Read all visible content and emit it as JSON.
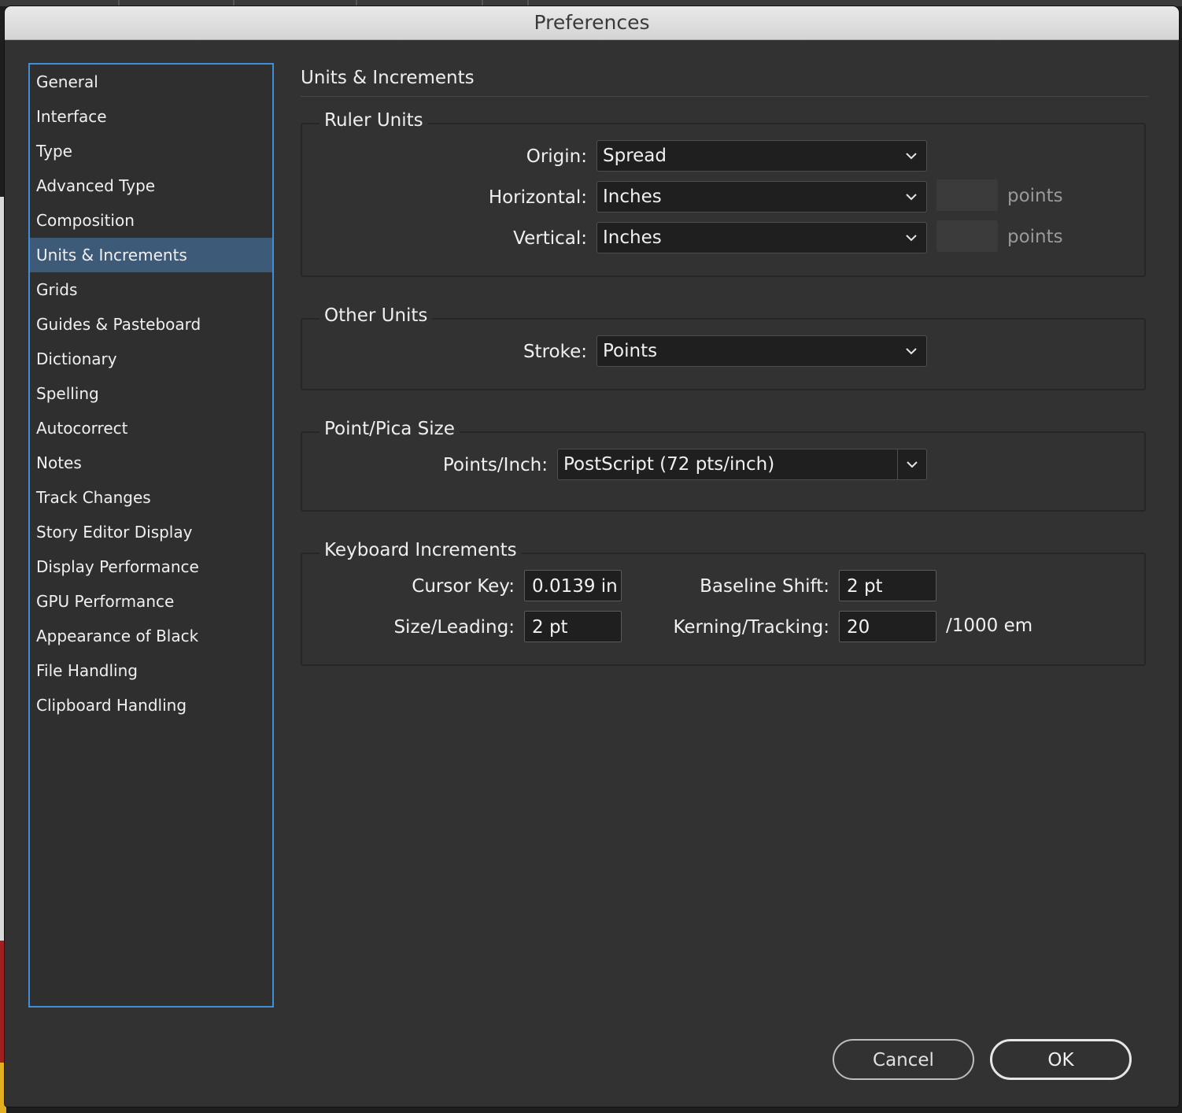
{
  "window": {
    "title": "Preferences"
  },
  "sidebar": {
    "items": [
      {
        "label": "General"
      },
      {
        "label": "Interface"
      },
      {
        "label": "Type"
      },
      {
        "label": "Advanced Type"
      },
      {
        "label": "Composition"
      },
      {
        "label": "Units & Increments",
        "selected": true
      },
      {
        "label": "Grids"
      },
      {
        "label": "Guides & Pasteboard"
      },
      {
        "label": "Dictionary"
      },
      {
        "label": "Spelling"
      },
      {
        "label": "Autocorrect"
      },
      {
        "label": "Notes"
      },
      {
        "label": "Track Changes"
      },
      {
        "label": "Story Editor Display"
      },
      {
        "label": "Display Performance"
      },
      {
        "label": "GPU Performance"
      },
      {
        "label": "Appearance of Black"
      },
      {
        "label": "File Handling"
      },
      {
        "label": "Clipboard Handling"
      }
    ]
  },
  "panel": {
    "title": "Units & Increments"
  },
  "ruler_units": {
    "title": "Ruler Units",
    "origin_label": "Origin:",
    "origin_value": "Spread",
    "horizontal_label": "Horizontal:",
    "horizontal_value": "Inches",
    "horizontal_unit": "points",
    "vertical_label": "Vertical:",
    "vertical_value": "Inches",
    "vertical_unit": "points"
  },
  "other_units": {
    "title": "Other Units",
    "stroke_label": "Stroke:",
    "stroke_value": "Points"
  },
  "point_pica": {
    "title": "Point/Pica Size",
    "points_inch_label": "Points/Inch:",
    "points_inch_value": "PostScript (72 pts/inch)"
  },
  "keyboard_increments": {
    "title": "Keyboard Increments",
    "cursor_key_label": "Cursor Key:",
    "cursor_key_value": "0.0139 in",
    "size_leading_label": "Size/Leading:",
    "size_leading_value": "2 pt",
    "baseline_shift_label": "Baseline Shift:",
    "baseline_shift_value": "2 pt",
    "kerning_label": "Kerning/Tracking:",
    "kerning_value": "20",
    "kerning_suffix": "/1000 em"
  },
  "buttons": {
    "cancel": "Cancel",
    "ok": "OK"
  },
  "colors": {
    "selection": "#3e5a79",
    "focus_border": "#3f8fd8",
    "dialog_bg": "#323232"
  },
  "icons": {
    "dropdown": "chevron-down-icon"
  }
}
